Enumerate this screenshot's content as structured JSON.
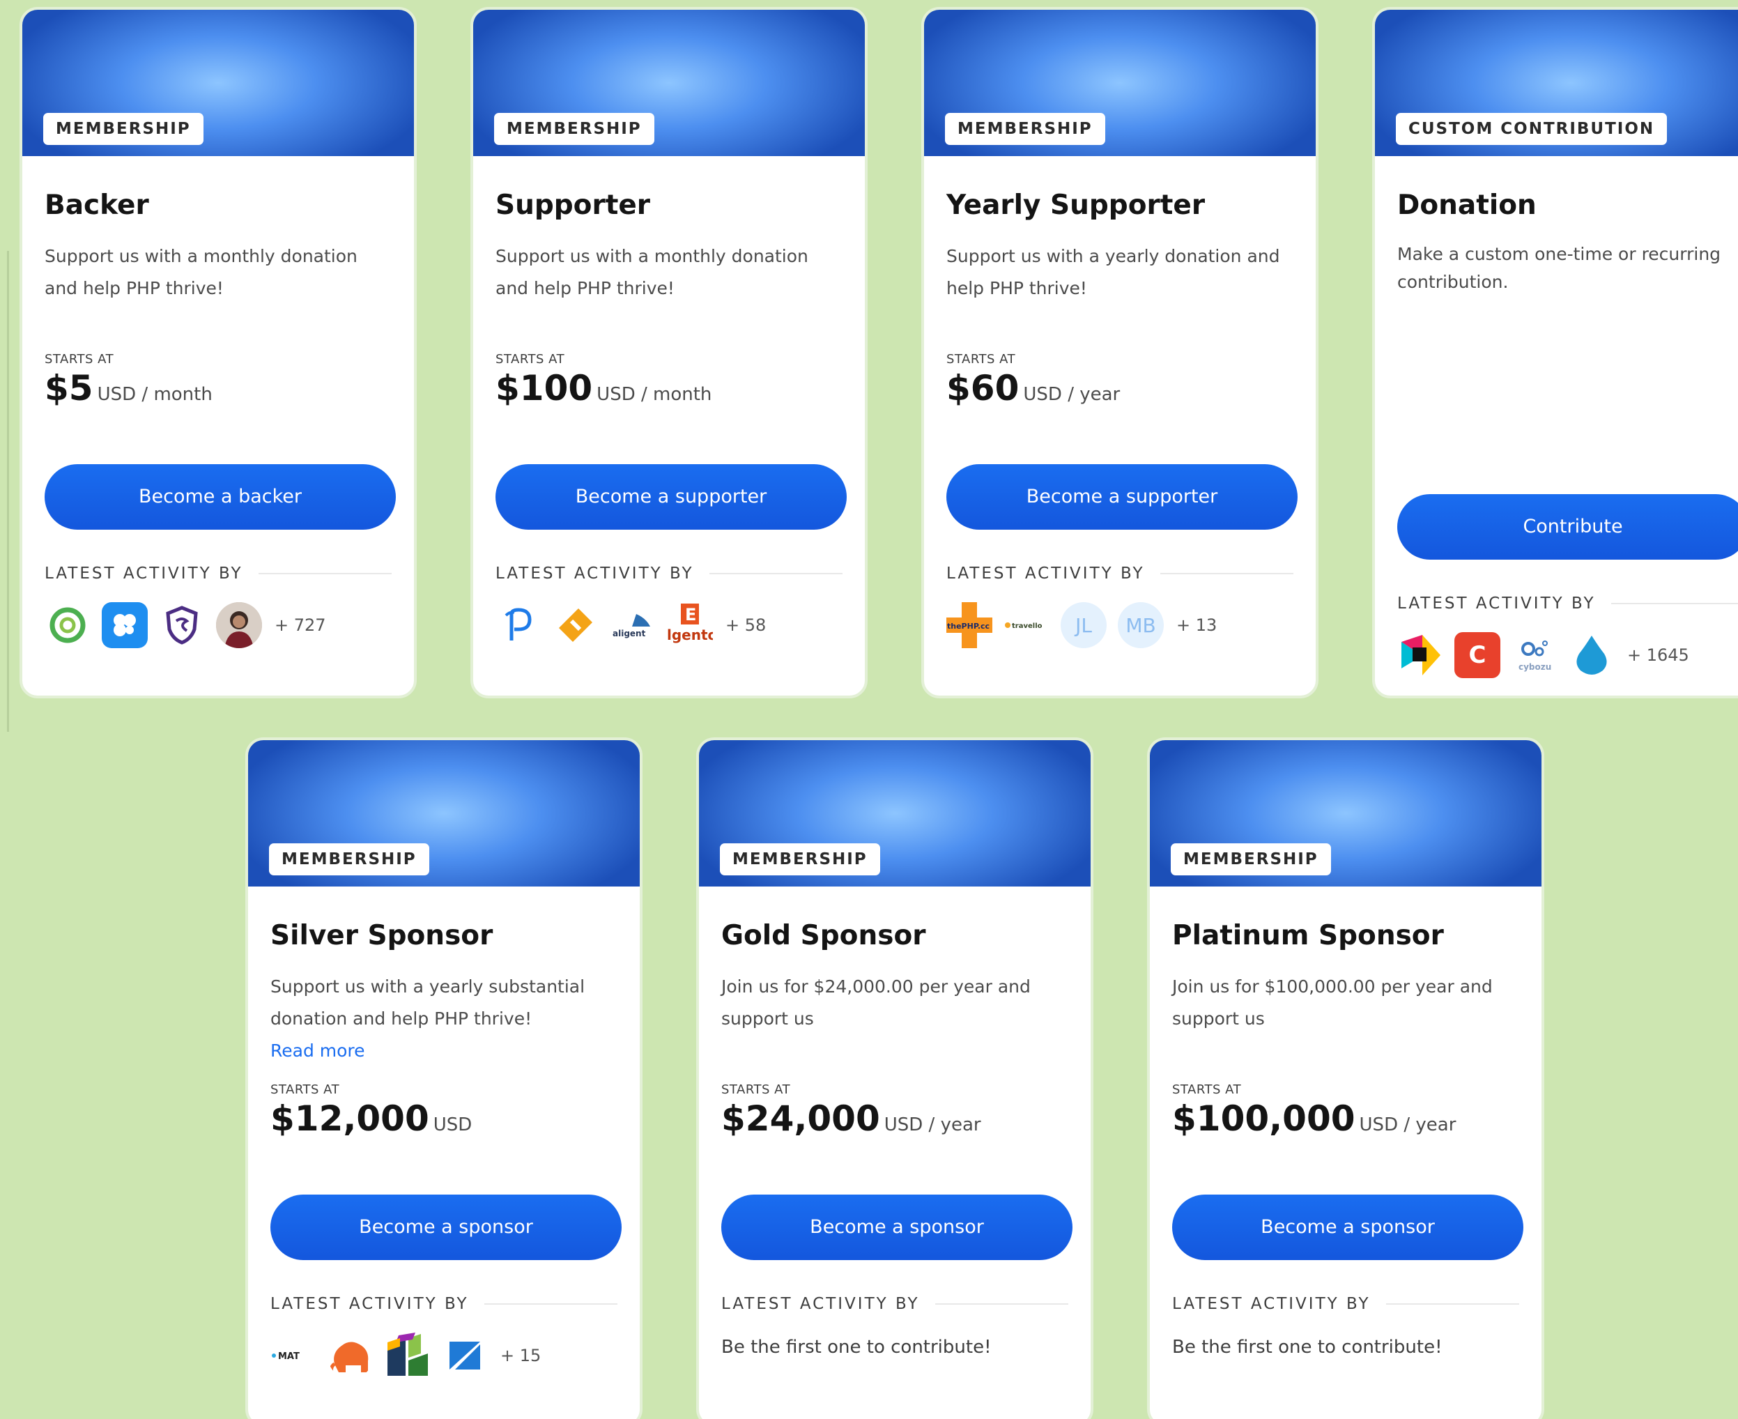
{
  "colors": {
    "background": "#cde6b1",
    "button": "#1a6df0",
    "link": "#1a6df0"
  },
  "common": {
    "starts_at": "STARTS AT",
    "latest_activity": "LATEST ACTIVITY BY"
  },
  "cards": [
    {
      "tag": "MEMBERSHIP",
      "title": "Backer",
      "description": "Support us with a monthly donation and help PHP thrive!",
      "price": "$5",
      "unit": "USD / month",
      "button": "Become a backer",
      "more": "+ 727",
      "avatars": [
        "green-ring-logo",
        "blue-flower-logo",
        "purple-shield-logo",
        "person-photo"
      ]
    },
    {
      "tag": "MEMBERSHIP",
      "title": "Supporter",
      "description": "Support us with a monthly donation and help PHP thrive!",
      "price": "$100",
      "unit": "USD / month",
      "button": "Become a supporter",
      "more": "+ 58",
      "avatars": [
        "p-logo",
        "orange-tag-logo",
        "aligent-logo",
        "magento-logo"
      ],
      "avatar_text": {
        "aligent": "aligent",
        "magento": "lgento"
      }
    },
    {
      "tag": "MEMBERSHIP",
      "title": "Yearly Supporter",
      "description": "Support us with a yearly donation and help PHP thrive!",
      "price": "$60",
      "unit": "USD / year",
      "button": "Become a supporter",
      "more": "+ 13",
      "avatars": [
        "thephp-logo",
        "travello-logo",
        "jl-initials",
        "mb-initials"
      ],
      "avatar_text": {
        "thephp": "thePHP.cc",
        "travello": "travello",
        "jl": "JL",
        "mb": "MB"
      }
    },
    {
      "tag": "CUSTOM CONTRIBUTION",
      "title": "Donation",
      "description": "Make a custom one-time or recurring contribution.",
      "button": "Contribute",
      "more": "+ 1645",
      "avatars": [
        "colorful-play-logo",
        "red-c-logo",
        "cybozu-logo",
        "drupal-drop-logo"
      ],
      "avatar_text": {
        "c": "C",
        "cybozu": "cybozu"
      }
    },
    {
      "tag": "MEMBERSHIP",
      "title": "Silver Sponsor",
      "description": "Support us with a yearly substantial donation and help PHP thrive!",
      "read_more": "Read more",
      "price": "$12,000",
      "unit": "USD",
      "button": "Become a sponsor",
      "more": "+ 15",
      "avatars": [
        "mat-logo",
        "orange-elephant-logo",
        "colorful-blocks-logo",
        "zend-logo"
      ],
      "avatar_text": {
        "mat": "MAT"
      }
    },
    {
      "tag": "MEMBERSHIP",
      "title": "Gold Sponsor",
      "description": "Join us for $24,000.00 per year and support us",
      "price": "$24,000",
      "unit": "USD / year",
      "button": "Become a sponsor",
      "first": "Be the first one to contribute!"
    },
    {
      "tag": "MEMBERSHIP",
      "title": "Platinum Sponsor",
      "description": "Join us for $100,000.00 per year and support us",
      "price": "$100,000",
      "unit": "USD / year",
      "button": "Become a sponsor",
      "first": "Be the first one to contribute!"
    }
  ]
}
